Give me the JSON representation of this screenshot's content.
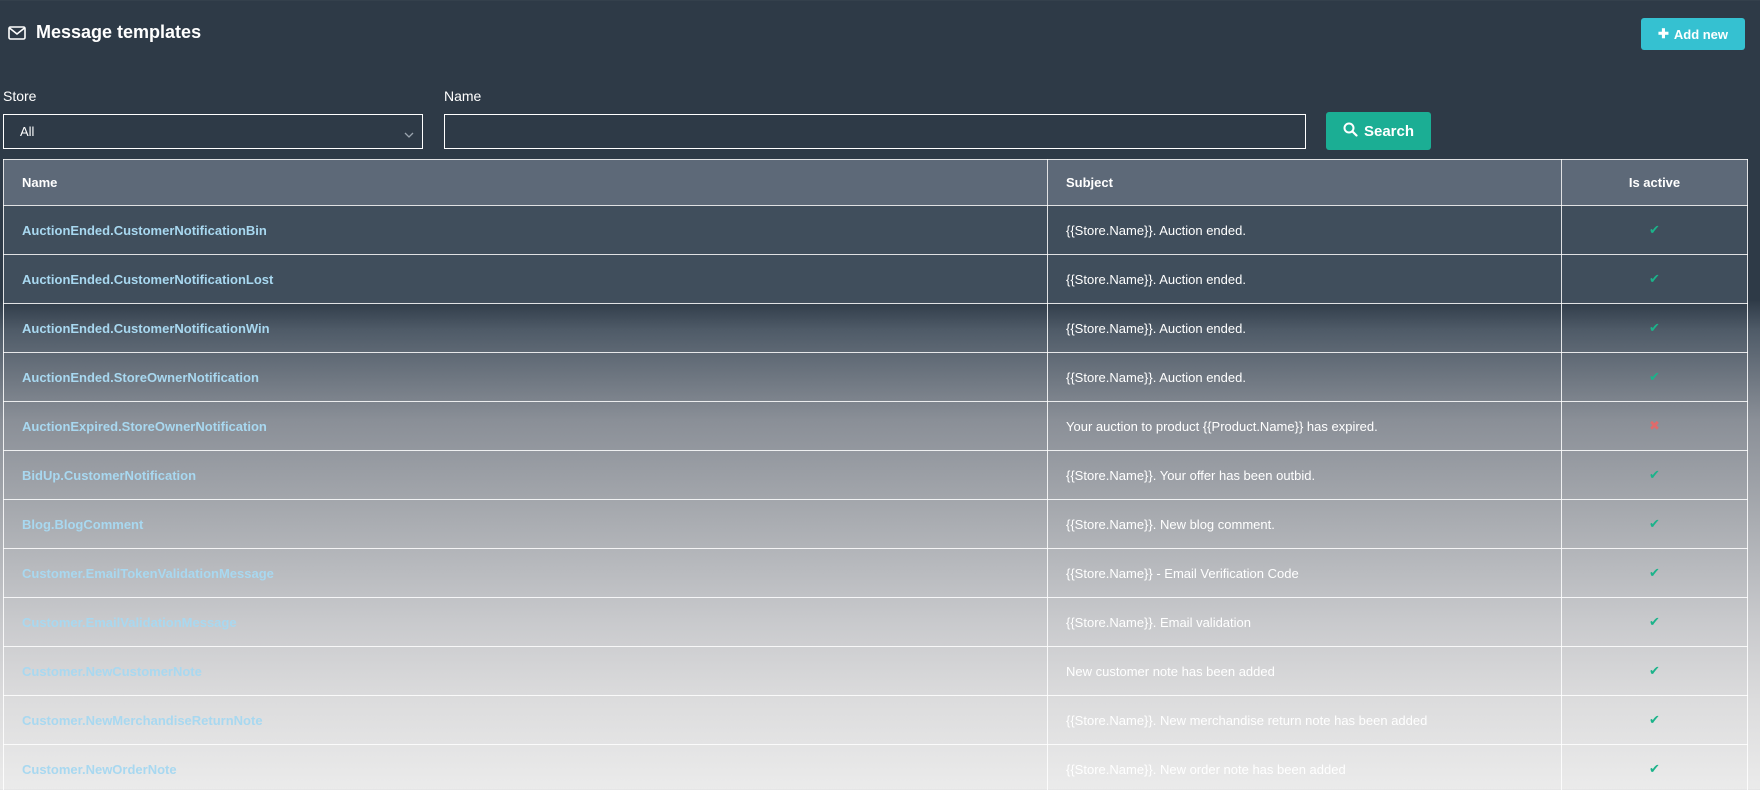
{
  "header": {
    "title": "Message templates",
    "add_button": "Add new"
  },
  "filters": {
    "store_label": "Store",
    "store_value": "All",
    "name_label": "Name",
    "name_value": "",
    "search_button": "Search"
  },
  "table": {
    "columns": [
      "Name",
      "Subject",
      "Is active"
    ],
    "rows": [
      {
        "name": "AuctionEnded.CustomerNotificationBin",
        "subject": "{{Store.Name}}. Auction ended.",
        "active": true
      },
      {
        "name": "AuctionEnded.CustomerNotificationLost",
        "subject": "{{Store.Name}}. Auction ended.",
        "active": true
      },
      {
        "name": "AuctionEnded.CustomerNotificationWin",
        "subject": "{{Store.Name}}. Auction ended.",
        "active": true
      },
      {
        "name": "AuctionEnded.StoreOwnerNotification",
        "subject": "{{Store.Name}}. Auction ended.",
        "active": true
      },
      {
        "name": "AuctionExpired.StoreOwnerNotification",
        "subject": "Your auction to product {{Product.Name}} has expired.",
        "active": false
      },
      {
        "name": "BidUp.CustomerNotification",
        "subject": "{{Store.Name}}. Your offer has been outbid.",
        "active": true
      },
      {
        "name": "Blog.BlogComment",
        "subject": "{{Store.Name}}. New blog comment.",
        "active": true
      },
      {
        "name": "Customer.EmailTokenValidationMessage",
        "subject": "{{Store.Name}} - Email Verification Code",
        "active": true
      },
      {
        "name": "Customer.EmailValidationMessage",
        "subject": "{{Store.Name}}. Email validation",
        "active": true
      },
      {
        "name": "Customer.NewCustomerNote",
        "subject": "New customer note has been added",
        "active": true
      },
      {
        "name": "Customer.NewMerchandiseReturnNote",
        "subject": "{{Store.Name}}. New merchandise return note has been added",
        "active": true
      },
      {
        "name": "Customer.NewOrderNote",
        "subject": "{{Store.Name}}. New order note has been added",
        "active": true
      }
    ]
  },
  "icons": {
    "title_icon": "envelope-icon",
    "add_icon": "plus-icon",
    "search_icon": "search-icon",
    "active_icon": "check-icon",
    "inactive_icon": "x-icon"
  },
  "colors": {
    "background_top": "#2e3a47",
    "add_button": "#35c1d1",
    "search_button": "#1bae94",
    "link": "#a8d8f0",
    "check": "#1bb38a",
    "cross": "#e06b6b"
  }
}
